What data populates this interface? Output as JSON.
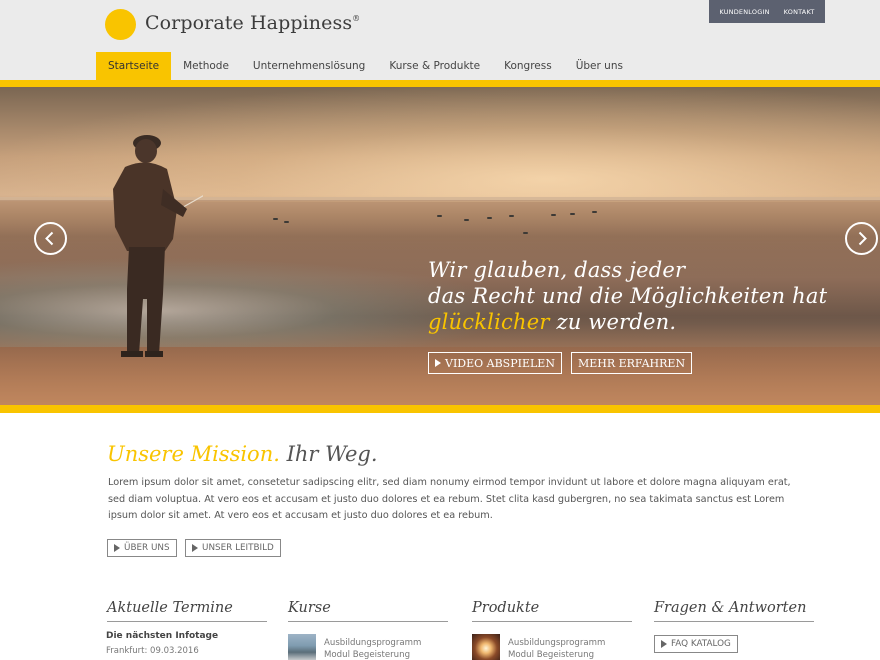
{
  "header": {
    "logo_text": "Corporate Happiness",
    "logo_reg": "®",
    "top_links": [
      "KUNDENLOGIN",
      "KONTAKT"
    ]
  },
  "nav": {
    "items": [
      "Startseite",
      "Methode",
      "Unternehmenslösung",
      "Kurse & Produkte",
      "Kongress",
      "Über uns"
    ],
    "active_index": 0
  },
  "hero": {
    "line1": "Wir glauben, dass jeder",
    "line2": "das Recht und die Möglichkeiten hat",
    "highlight": "glücklicher",
    "line3_rest": " zu werden.",
    "buttons": [
      "VIDEO ABSPIELEN",
      "MEHR ERFAHREN"
    ],
    "prev_icon": "chevron-left-icon",
    "next_icon": "chevron-right-icon"
  },
  "mission": {
    "title_highlight": "Unsere Mission.",
    "title_rest": "Ihr Weg.",
    "body": "Lorem ipsum dolor sit amet, consetetur sadipscing elitr, sed diam nonumy eirmod tempor invidunt ut labore et dolore magna aliquyam erat, sed diam voluptua. At vero eos et accusam et justo duo dolores et ea rebum. Stet clita kasd gubergren, no sea takimata sanctus est Lorem ipsum dolor sit amet. At vero eos et accusam et justo duo dolores et ea rebum.",
    "buttons": [
      "ÜBER UNS",
      "UNSER LEITBILD"
    ]
  },
  "columns": {
    "termine": {
      "title": "Aktuelle Termine",
      "item_title": "Die nächsten Infotage",
      "item_sub": "Frankfurt: 09.03.2016"
    },
    "kurse": {
      "title": "Kurse",
      "item_line1": "Ausbildungsprogramm",
      "item_line2": "Modul Begeisterung"
    },
    "produkte": {
      "title": "Produkte",
      "item_line1": "Ausbildungsprogramm",
      "item_line2": "Modul Begeisterung"
    },
    "faq": {
      "title": "Fragen & Antworten",
      "button": "FAQ KATALOG"
    }
  },
  "colors": {
    "accent": "#f9c400",
    "topbar": "#5c6170",
    "header_bg": "#ebebeb"
  }
}
